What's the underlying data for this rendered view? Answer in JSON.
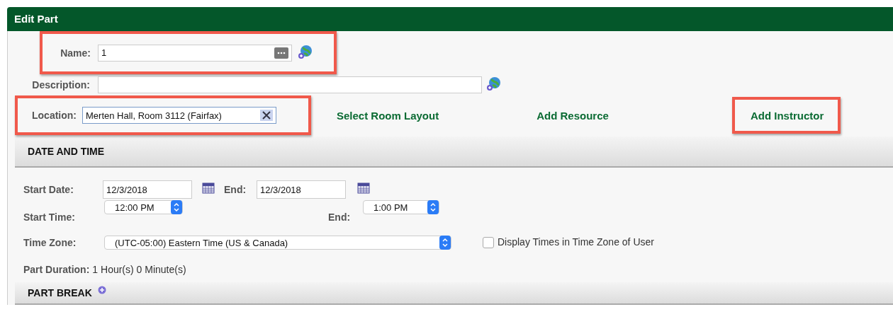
{
  "window": {
    "title": "Edit Part"
  },
  "name_field": {
    "label": "Name:",
    "value": "1",
    "highlighted": true
  },
  "description_field": {
    "label": "Description:"
  },
  "location_field": {
    "label": "Location:",
    "value": "Merten Hall, Room 3112 (Fairfax)",
    "highlighted": true
  },
  "links": [
    {
      "label": "Select Room Layout",
      "highlighted": false
    },
    {
      "label": "Add Resource",
      "highlighted": false
    },
    {
      "label": "Add Instructor",
      "highlighted": true
    }
  ],
  "date_and_time": {
    "title": "DATE AND TIME",
    "start_date": {
      "label": "Start Date:",
      "value": "12/3/2018"
    },
    "end_date": {
      "label": "End:",
      "value": "12/3/2018"
    },
    "start_time": {
      "label": "Start Time:",
      "value": "12:00 PM"
    },
    "end_time": {
      "label": "End:",
      "value": "1:00 PM"
    },
    "time_zone": {
      "label": "Time Zone:",
      "value": "(UTC-05:00) Eastern Time (US & Canada)"
    },
    "user_time_zone": {
      "label": "Display Times in Time Zone of User",
      "checked": false
    },
    "duration": {
      "label": "Part Duration:",
      "value": "1 Hour(s) 0 Minute(s)"
    }
  },
  "part_break": {
    "title": "PART BREAK"
  }
}
